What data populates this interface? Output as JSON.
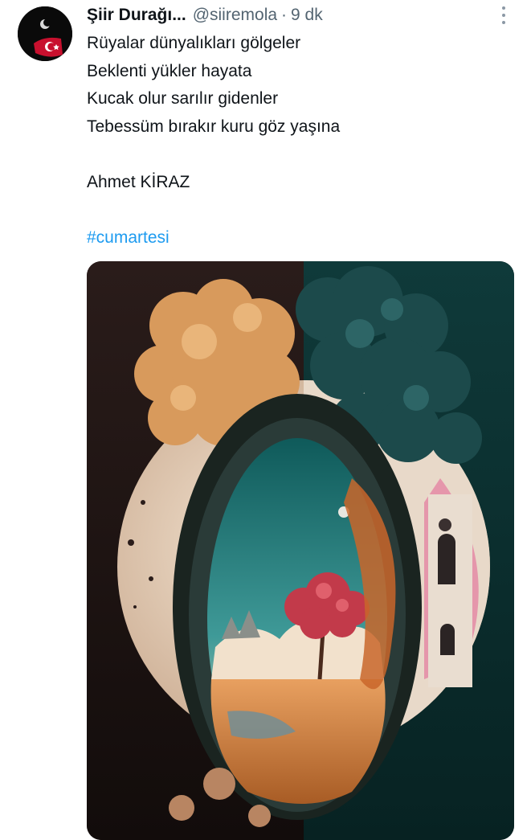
{
  "tweet": {
    "author_name": "Şiir Durağı...",
    "handle": "@siiremola",
    "separator": "·",
    "time": "9 dk",
    "lines": [
      "Rüyalar dünyalıkları gölgeler",
      "Beklenti yükler hayata",
      "Kucak olur sarılır gidenler",
      "Tebessüm bırakır kuru göz yaşına",
      "",
      "Ahmet KİRAZ",
      "",
      "#cumartesi"
    ],
    "hashtag_color": "#1d9bf0",
    "icons": {
      "avatar": "turkish-flag-crescent-avatar",
      "more": "more-vertical-icon"
    }
  }
}
